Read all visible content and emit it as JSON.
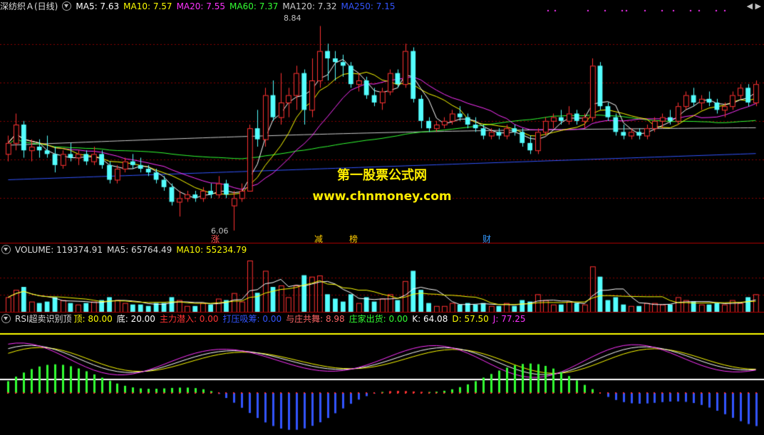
{
  "price_panel": {
    "name": "深纺织Ａ(日线)",
    "ma": [
      {
        "label": "MA5: 7.63",
        "color": "#ffffff"
      },
      {
        "label": "MA10: 7.57",
        "color": "#ffff00"
      },
      {
        "label": "MA20: 7.55",
        "color": "#ff33ff"
      },
      {
        "label": "MA60: 7.37",
        "color": "#33ff33"
      },
      {
        "label": "MA120: 7.32",
        "color": "#cccccc"
      },
      {
        "label": "MA250: 7.15",
        "color": "#3355ff"
      }
    ],
    "high_mark": "8.84",
    "low_mark": "6.06",
    "watermark_line1": "第一股票公式网",
    "watermark_line2": "www.chnmoney.com",
    "signals": [
      {
        "text": "涨",
        "color": "#ff5555"
      },
      {
        "text": "减",
        "color": "#ffcc00"
      },
      {
        "text": "榜",
        "color": "#ffcc00"
      },
      {
        "text": "财",
        "color": "#3399ff"
      }
    ]
  },
  "volume_panel": {
    "title": "VOLUME: 119374.91",
    "ma5": "MA5: 65764.49",
    "ma10": "MA10: 55234.79"
  },
  "rsi_panel": {
    "title": "RSI超卖识别顶",
    "top": "顶: 80.00",
    "bottom": "底: 20.00",
    "main_entry": "主力潜入: 0.00",
    "press": "打压吸筹: 0.00",
    "dance": "与庄共舞: 8.98",
    "ship": "庄家出货: 0.00",
    "k": "K: 64.08",
    "d": "D: 57.50",
    "j": "J: 77.25"
  },
  "colors": {
    "up": "#ff3232",
    "down": "#54ffff",
    "grid": "#8b0000",
    "divider": "#b00000"
  },
  "chart_data": {
    "type": "candlestick",
    "ohlc": [
      [
        7.1,
        7.35,
        7.0,
        7.25
      ],
      [
        7.25,
        7.65,
        7.15,
        7.5
      ],
      [
        7.5,
        7.55,
        7.05,
        7.15
      ],
      [
        7.15,
        7.3,
        7.0,
        7.2
      ],
      [
        7.2,
        7.3,
        7.05,
        7.15
      ],
      [
        7.15,
        7.35,
        7.05,
        7.1
      ],
      [
        7.1,
        7.2,
        6.85,
        6.95
      ],
      [
        6.95,
        7.15,
        6.9,
        7.1
      ],
      [
        7.1,
        7.25,
        7.0,
        7.05
      ],
      [
        7.05,
        7.15,
        6.95,
        7.1
      ],
      [
        7.1,
        7.15,
        6.95,
        7.0
      ],
      [
        7.0,
        7.2,
        6.95,
        7.1
      ],
      [
        7.1,
        7.15,
        6.9,
        6.95
      ],
      [
        6.95,
        7.0,
        6.7,
        6.75
      ],
      [
        6.75,
        6.95,
        6.7,
        6.9
      ],
      [
        6.9,
        7.05,
        6.85,
        7.0
      ],
      [
        7.0,
        7.1,
        6.9,
        6.95
      ],
      [
        6.95,
        7.05,
        6.85,
        6.9
      ],
      [
        6.9,
        6.95,
        6.8,
        6.85
      ],
      [
        6.85,
        6.9,
        6.7,
        6.75
      ],
      [
        6.75,
        6.8,
        6.6,
        6.65
      ],
      [
        6.65,
        6.7,
        6.4,
        6.45
      ],
      [
        6.45,
        6.6,
        6.25,
        6.5
      ],
      [
        6.5,
        6.6,
        6.45,
        6.55
      ],
      [
        6.55,
        6.6,
        6.45,
        6.5
      ],
      [
        6.5,
        6.65,
        6.45,
        6.6
      ],
      [
        6.6,
        6.7,
        6.5,
        6.55
      ],
      [
        6.55,
        6.8,
        6.5,
        6.7
      ],
      [
        6.7,
        6.75,
        6.5,
        6.55
      ],
      [
        6.4,
        6.6,
        6.06,
        6.5
      ],
      [
        6.5,
        6.7,
        6.45,
        6.6
      ],
      [
        6.6,
        7.5,
        6.6,
        7.45
      ],
      [
        7.45,
        7.7,
        7.2,
        7.3
      ],
      [
        7.3,
        8.0,
        7.2,
        7.9
      ],
      [
        7.9,
        8.1,
        7.55,
        7.6
      ],
      [
        7.6,
        8.2,
        7.5,
        7.8
      ],
      [
        7.8,
        8.0,
        7.6,
        7.9
      ],
      [
        7.9,
        8.3,
        7.7,
        8.2
      ],
      [
        8.2,
        8.25,
        7.5,
        7.7
      ],
      [
        7.7,
        8.4,
        7.6,
        8.1
      ],
      [
        8.1,
        8.84,
        8.0,
        8.5
      ],
      [
        8.5,
        8.6,
        8.1,
        8.4
      ],
      [
        8.4,
        8.5,
        8.1,
        8.35
      ],
      [
        8.35,
        8.45,
        8.15,
        8.3
      ],
      [
        8.3,
        8.35,
        8.0,
        8.05
      ],
      [
        8.05,
        8.2,
        7.95,
        8.1
      ],
      [
        8.1,
        8.15,
        7.85,
        7.9
      ],
      [
        7.9,
        8.0,
        7.75,
        7.8
      ],
      [
        7.8,
        8.0,
        7.7,
        7.95
      ],
      [
        7.95,
        8.25,
        7.9,
        8.2
      ],
      [
        8.2,
        8.25,
        8.0,
        8.05
      ],
      [
        8.05,
        8.6,
        8.0,
        8.5
      ],
      [
        8.5,
        8.55,
        7.8,
        7.85
      ],
      [
        7.85,
        7.9,
        7.45,
        7.55
      ],
      [
        7.55,
        7.6,
        7.4,
        7.45
      ],
      [
        7.45,
        7.55,
        7.4,
        7.5
      ],
      [
        7.5,
        7.6,
        7.45,
        7.55
      ],
      [
        7.55,
        7.7,
        7.5,
        7.65
      ],
      [
        7.65,
        7.75,
        7.55,
        7.6
      ],
      [
        7.6,
        7.65,
        7.45,
        7.5
      ],
      [
        7.5,
        7.6,
        7.4,
        7.45
      ],
      [
        7.45,
        7.5,
        7.3,
        7.35
      ],
      [
        7.35,
        7.45,
        7.3,
        7.4
      ],
      [
        7.4,
        7.45,
        7.3,
        7.35
      ],
      [
        7.35,
        7.5,
        7.3,
        7.45
      ],
      [
        7.45,
        7.5,
        7.35,
        7.4
      ],
      [
        7.4,
        7.45,
        7.2,
        7.25
      ],
      [
        7.25,
        7.35,
        7.1,
        7.15
      ],
      [
        7.15,
        7.45,
        7.1,
        7.4
      ],
      [
        7.4,
        7.6,
        7.35,
        7.55
      ],
      [
        7.55,
        7.65,
        7.45,
        7.6
      ],
      [
        7.6,
        7.7,
        7.5,
        7.55
      ],
      [
        7.55,
        7.75,
        7.5,
        7.65
      ],
      [
        7.65,
        7.7,
        7.5,
        7.55
      ],
      [
        7.55,
        7.65,
        7.45,
        7.6
      ],
      [
        7.6,
        8.4,
        7.55,
        8.3
      ],
      [
        8.3,
        8.35,
        7.7,
        7.75
      ],
      [
        7.75,
        7.8,
        7.55,
        7.6
      ],
      [
        7.6,
        7.65,
        7.35,
        7.4
      ],
      [
        7.4,
        7.5,
        7.3,
        7.35
      ],
      [
        7.35,
        7.45,
        7.3,
        7.4
      ],
      [
        7.4,
        7.45,
        7.3,
        7.35
      ],
      [
        7.35,
        7.5,
        7.3,
        7.45
      ],
      [
        7.45,
        7.6,
        7.4,
        7.55
      ],
      [
        7.55,
        7.65,
        7.45,
        7.6
      ],
      [
        7.6,
        7.7,
        7.5,
        7.55
      ],
      [
        7.55,
        7.8,
        7.5,
        7.75
      ],
      [
        7.75,
        7.95,
        7.7,
        7.9
      ],
      [
        7.9,
        8.0,
        7.75,
        7.8
      ],
      [
        7.8,
        7.9,
        7.7,
        7.85
      ],
      [
        7.85,
        7.95,
        7.75,
        7.8
      ],
      [
        7.8,
        7.85,
        7.65,
        7.7
      ],
      [
        7.7,
        7.8,
        7.6,
        7.75
      ],
      [
        7.75,
        7.95,
        7.7,
        7.9
      ],
      [
        7.9,
        8.05,
        7.85,
        8.0
      ],
      [
        8.0,
        8.05,
        7.75,
        7.8
      ],
      [
        7.8,
        8.1,
        7.75,
        8.05
      ]
    ],
    "ylim": [
      6.0,
      9.0
    ]
  }
}
